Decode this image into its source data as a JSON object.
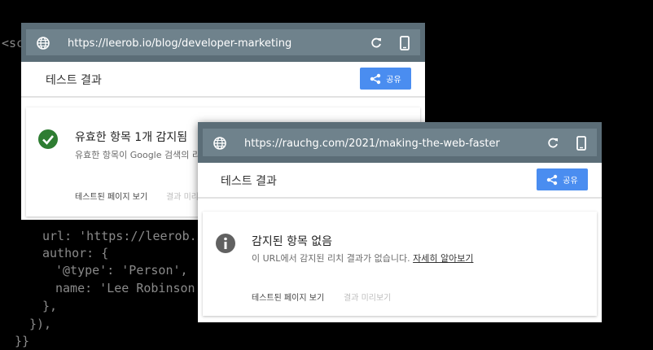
{
  "background_code": {
    "lines": [
      "<sc",
      "url: 'https://leerob.i",
      "author: {",
      "'@type': 'Person',",
      "name: 'Lee Robinson'",
      "},",
      "}),",
      "}}"
    ]
  },
  "window1": {
    "url": "https://leerob.io/blog/developer-marketing",
    "toolbar_title": "테스트 결과",
    "share_label": "공유",
    "result": {
      "title": "유효한 항목 1개 감지됨",
      "description": "유효한 항목이 Google 검색의 리치",
      "action_view_tested": "테스트된 페이지 보기",
      "action_preview": "결과 미리"
    }
  },
  "window2": {
    "url": "https://rauchg.com/2021/making-the-web-faster",
    "toolbar_title": "테스트 결과",
    "share_label": "공유",
    "result": {
      "title": "감지된 항목 없음",
      "description": "이 URL에서 감지된 리치 결과가 없습니다.",
      "learn_more": "자세히 알아보기",
      "action_view_tested": "테스트된 페이지 보기",
      "action_preview": "결과 미리보기"
    }
  },
  "colors": {
    "address_bar": "#5b6d77",
    "share_button": "#4a8df0",
    "success_icon": "#2e7d32",
    "info_icon": "#616161"
  }
}
